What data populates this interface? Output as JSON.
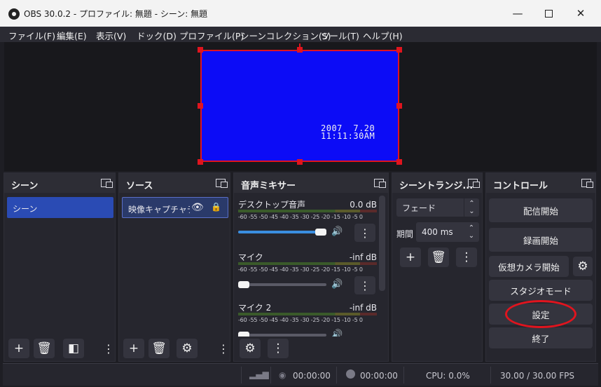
{
  "window": {
    "title": "OBS 30.0.2 - プロファイル: 無題 - シーン: 無題",
    "minimize_icon": "minimize-icon",
    "maximize_icon": "maximize-icon",
    "close_icon": "close-icon"
  },
  "menu": [
    "ファイル(F)",
    "編集(E)",
    "表示(V)",
    "ドック(D)",
    "プロファイル(P)",
    "シーンコレクション(S)",
    "ツール(T)",
    "ヘルプ(H)"
  ],
  "preview": {
    "date_stamp": "2007  7.20",
    "time_stamp": "11:11:30AM",
    "source_color": "#0c0cf6",
    "selection_color": "#e0141e"
  },
  "docks": {
    "scenes": {
      "title": "シーン",
      "items": [
        "シーン"
      ]
    },
    "sources": {
      "title": "ソース",
      "items": [
        "映像キャプチャデバイス"
      ]
    },
    "mixer": {
      "title": "音声ミキサー",
      "scale": "-60 -55 -50 -45 -40 -35 -30 -25 -20 -15 -10  -5   0",
      "channels": [
        {
          "name": "デスクトップ音声",
          "db": "0.0 dB",
          "volume": 1.0
        },
        {
          "name": "マイク",
          "db": "-inf dB",
          "volume": 0.0
        },
        {
          "name": "マイク 2",
          "db": "-inf dB",
          "volume": 0.0
        }
      ]
    },
    "transitions": {
      "title": "シーントランジ...",
      "selected": "フェード",
      "duration_label": "期間",
      "duration_value": "400 ms"
    },
    "controls": {
      "title": "コントロール",
      "start_streaming": "配信開始",
      "start_recording": "録画開始",
      "start_virtual_camera": "仮想カメラ開始",
      "studio_mode": "スタジオモード",
      "settings": "設定",
      "exit": "終了"
    }
  },
  "status": {
    "stream_time": "00:00:00",
    "record_time": "00:00:00",
    "cpu": "CPU: 0.0%",
    "fps": "30.00 / 30.00 FPS"
  }
}
